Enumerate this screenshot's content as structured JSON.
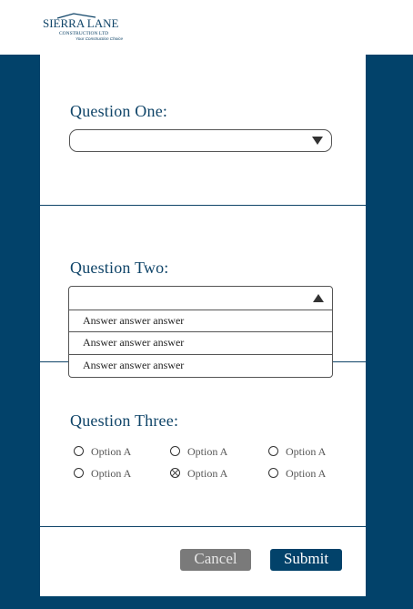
{
  "brand": {
    "name_line1": "SIERRA LANE",
    "name_line2": "CONSTRUCTION LTD",
    "tagline": "Your Construction Choice",
    "color": "#0f4468"
  },
  "questions": {
    "q1": {
      "label": "Question One:",
      "value": ""
    },
    "q2": {
      "label": "Question Two:",
      "value": "",
      "options": [
        "Answer answer answer",
        "Answer answer answer",
        "Answer answer answer"
      ]
    },
    "q3": {
      "label": "Question Three:",
      "options": [
        {
          "label": "Option A",
          "checked": false
        },
        {
          "label": "Option A",
          "checked": false
        },
        {
          "label": "Option A",
          "checked": false
        },
        {
          "label": "Option A",
          "checked": false
        },
        {
          "label": "Option A",
          "checked": true
        },
        {
          "label": "Option A",
          "checked": false
        }
      ]
    }
  },
  "buttons": {
    "cancel": "Cancel",
    "submit": "Submit"
  },
  "icons": {
    "dropdown_closed": "caret-down-icon",
    "dropdown_open": "caret-up-icon",
    "radio": "radio-circle-icon",
    "radio_selected": "radio-x-icon"
  }
}
